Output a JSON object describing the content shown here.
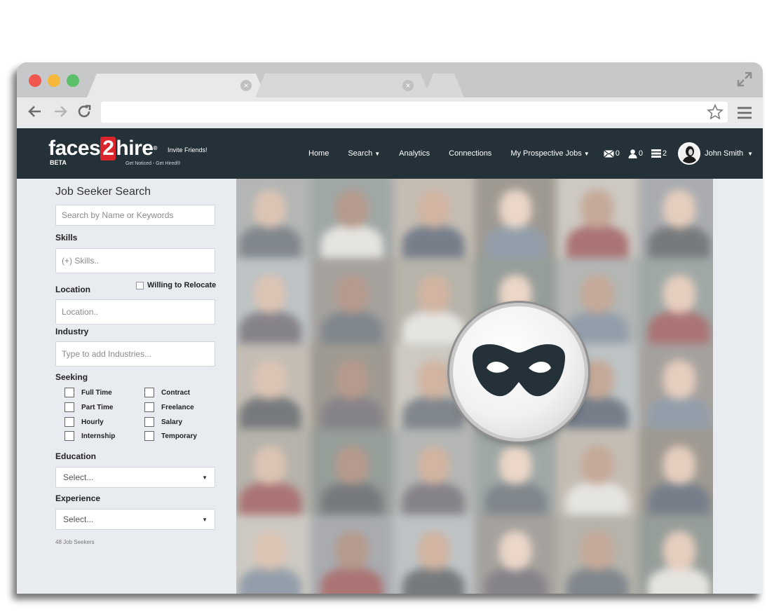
{
  "browser": {
    "address_value": ""
  },
  "site": {
    "logo": {
      "pre": "faces",
      "two": "2",
      "post": "hire",
      "reg": "®",
      "beta": "BETA",
      "invite": "Invite Friends!",
      "tagline": "Get Noticed - Get Hired®"
    },
    "nav": {
      "home": "Home",
      "search": "Search",
      "analytics": "Analytics",
      "connections": "Connections",
      "prospective_jobs": "My Prospective Jobs",
      "messages_count": "0",
      "connections_count": "0",
      "jobs_count": "2",
      "user_name": "John Smith"
    }
  },
  "sidebar": {
    "title": "Job Seeker Search",
    "search_placeholder": "Search by Name or Keywords",
    "skills_label": "Skills",
    "skills_placeholder": "(+) Skills..",
    "location_label": "Location",
    "relocate_label": "Willing to Relocate",
    "location_placeholder": "Location..",
    "industry_label": "Industry",
    "industry_placeholder": "Type to add Industries...",
    "seeking_label": "Seeking",
    "seeking_options": [
      "Full Time",
      "Part Time",
      "Hourly",
      "Internship",
      "Contract",
      "Freelance",
      "Salary",
      "Temporary"
    ],
    "education_label": "Education",
    "education_value": "Select...",
    "experience_label": "Experience",
    "experience_value": "Select...",
    "result_count": "48 Job Seekers"
  },
  "colors": {
    "nav_bg": "#243139",
    "logo_accent": "#d9252b",
    "mask": "#243139"
  }
}
